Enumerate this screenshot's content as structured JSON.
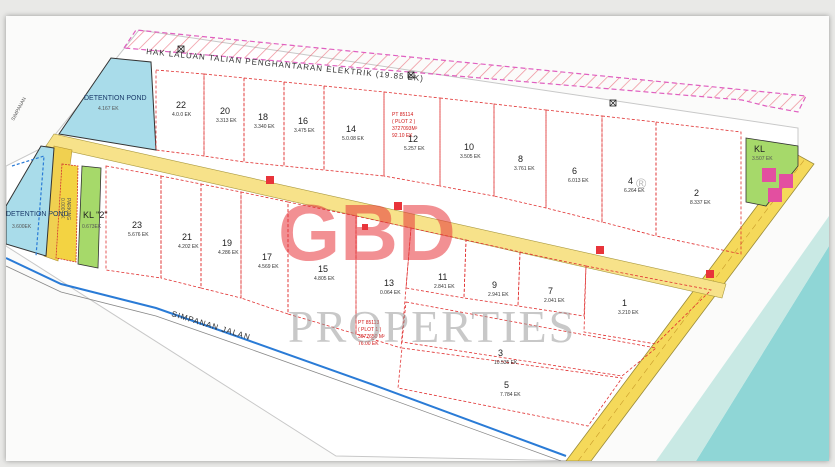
{
  "map": {
    "top_road_label": "HAK  LALUAN  TALIAN  PENGHANTARAN ELEKTRIK (19.85 EK)",
    "bottom_road_label": "SIMPANAN  JALAN",
    "left_margin_text": "SIMPANAN",
    "ponds": [
      {
        "id": "pond-top",
        "name": "DETENTION POND",
        "area": "4.167 EK"
      },
      {
        "id": "pond-left",
        "name": "DETENTION POND",
        "area": "3.600EK"
      }
    ],
    "reserves": [
      {
        "id": "kl2",
        "name": "KL \"2\"",
        "area": "0.673EK"
      },
      {
        "id": "kl-right",
        "name": "KL",
        "area": "3.507 EK"
      },
      {
        "id": "parking",
        "name": "PARKING",
        "area": "0.000 EK"
      }
    ],
    "plot_labels": [
      {
        "id": "plot2",
        "lines": [
          "PT 85114",
          "( PLOT 2 )",
          "3727093M²",
          "92.10 EK"
        ]
      },
      {
        "id": "plot1",
        "lines": [
          "PT 85113",
          "( PLOT 1 )",
          "3077650 M²",
          "76.00 EK"
        ]
      }
    ],
    "lots": [
      {
        "no": "22",
        "area": "4.0.0 EK"
      },
      {
        "no": "20",
        "area": "3.313 EK"
      },
      {
        "no": "18",
        "area": "3.340 EK"
      },
      {
        "no": "16",
        "area": "3.475 EK"
      },
      {
        "no": "14",
        "area": "5.0.08 EK"
      },
      {
        "no": "12",
        "area": "5.257 EK"
      },
      {
        "no": "10",
        "area": "3.505 EK"
      },
      {
        "no": "8",
        "area": "3.761 EK"
      },
      {
        "no": "6",
        "area": "6.013 EK"
      },
      {
        "no": "4",
        "area": "6.264 EK"
      },
      {
        "no": "2",
        "area": "8.337 EK"
      },
      {
        "no": "23",
        "area": "5.676 EK"
      },
      {
        "no": "21",
        "area": "4.202 EK"
      },
      {
        "no": "19",
        "area": "4.286 EK"
      },
      {
        "no": "17",
        "area": "4.569 EK"
      },
      {
        "no": "15",
        "area": "4.805 EK"
      },
      {
        "no": "13",
        "area": "0.064 EK"
      },
      {
        "no": "11",
        "area": "2.841 EK"
      },
      {
        "no": "9",
        "area": "2.941 EK"
      },
      {
        "no": "7",
        "area": "2.041 EK"
      },
      {
        "no": "1",
        "area": "3.210 EK"
      },
      {
        "no": "3",
        "area": "10.535 EK"
      },
      {
        "no": "5",
        "area": "7.784 EK"
      }
    ]
  },
  "watermark": {
    "logo_text": "GBD",
    "registered_mark": "®",
    "sub_text": "PROPERTIES"
  },
  "colors": {
    "detention_pond": "#a9dcea",
    "green_reserve": "#a6d96a",
    "road_yellow": "#f7dc57",
    "lot_border_red": "#e03030",
    "powerline_hatch": "#e85a6a",
    "watermark_red": "#e8343a",
    "river_teal": "#7fd3d0"
  }
}
